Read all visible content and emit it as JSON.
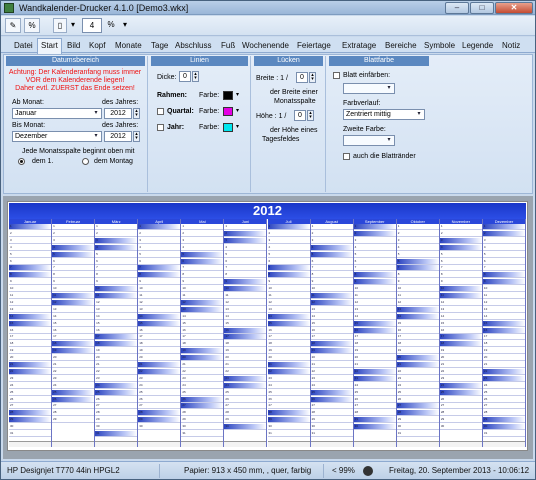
{
  "window": {
    "title": "Wandkalender-Drucker 4.1.0 [Demo3.wkx]"
  },
  "toolbar": {
    "zoom_value": "4",
    "zoom_unit": "%"
  },
  "tabs": [
    "Datei",
    "Start",
    "Bild",
    "Kopf",
    "Monate",
    "Tage",
    "Abschluss",
    "Fuß",
    "Wochenende",
    "Feiertage",
    "Extratage",
    "Bereiche",
    "Symbole",
    "Legende",
    "Notiz"
  ],
  "datumsbereich": {
    "title": "Datumsbereich",
    "warning": [
      "Achtung: Der Kalenderanfang muss immer",
      "VOR dem Kalenderende liegen!",
      "Daher evtl. ZUERST das Ende setzen!"
    ],
    "ab_monat_label": "Ab Monat:",
    "ab_monat_value": "Januar",
    "des_jahres_label": "des Jahres:",
    "ab_jahr": "2012",
    "bis_monat_label": "Bis Monat:",
    "bis_monat_value": "Dezember",
    "bis_jahr": "2012",
    "spalte_label": "Jede Monatsspalte beginnt oben mit",
    "radio_dem1": "dem 1.",
    "radio_montag": "dem Montag"
  },
  "linien": {
    "title": "Linien",
    "dicke_label": "Dicke:",
    "dicke_value": "0",
    "rahmen_label": "Rahmen:",
    "quartal_label": "Quartal:",
    "jahr_label": "Jahr:",
    "farbe_label": "Farbe:",
    "colors": {
      "rahmen": "#000000",
      "quartal": "#e400e4",
      "jahr": "#00e6ee"
    }
  },
  "luecken": {
    "title": "Lücken",
    "breite_label": "Breite : 1 /",
    "breite_value": "0",
    "breite_note": [
      "der Breite einer",
      "Monatsspalte"
    ],
    "hoehe_label": "Höhe : 1 /",
    "hoehe_value": "0",
    "hoehe_note": [
      "der Höhe eines",
      "Tagesfeldes"
    ]
  },
  "blattfarbe": {
    "title": "Blattfarbe",
    "blatt_label": "Blatt einfärben:",
    "farbverlauf_label": "Farbverlauf:",
    "farbverlauf_value": "Zentriert mittig",
    "zweite_farbe_label": "Zweite Farbe:",
    "auch_label": "auch die Blattränder"
  },
  "calendar": {
    "year": "2012",
    "months": [
      "Januar",
      "Februar",
      "März",
      "April",
      "Mai",
      "Juni",
      "Juli",
      "August",
      "September",
      "Oktober",
      "November",
      "Dezember"
    ],
    "first_weekday": [
      6,
      2,
      3,
      6,
      1,
      4,
      6,
      2,
      5,
      0,
      3,
      5
    ],
    "days_in_month": [
      31,
      29,
      31,
      30,
      31,
      30,
      31,
      31,
      30,
      31,
      30,
      31
    ]
  },
  "status": {
    "printer": "HP Designjet T770 44in HPGL2",
    "paper": "Papier: 913 x 450 mm, , quer, farbig",
    "zoom": "< 99%",
    "date": "Freitag, 20. September 2013 - 10:06:12"
  }
}
